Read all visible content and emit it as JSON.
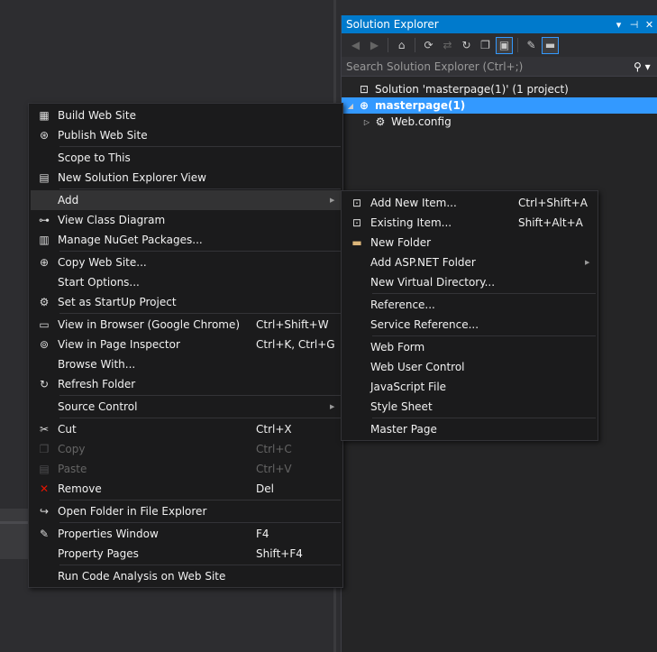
{
  "solution_explorer": {
    "title": "Solution Explorer",
    "title_buttons": [
      "▾",
      "⊣",
      "✕"
    ],
    "toolbar": [
      {
        "name": "back-icon",
        "glyph": "◀",
        "dim": true
      },
      {
        "name": "forward-icon",
        "glyph": "▶",
        "dim": true
      },
      {
        "name": "home-icon",
        "glyph": "⌂"
      },
      {
        "name": "sync-icon",
        "glyph": "⟳"
      },
      {
        "name": "pending-changes-icon",
        "glyph": "⇄",
        "dim": true
      },
      {
        "name": "refresh-icon",
        "glyph": "↻"
      },
      {
        "name": "collapse-all-icon",
        "glyph": "❐"
      },
      {
        "name": "show-all-files-icon",
        "glyph": "▣",
        "on": true
      },
      {
        "name": "properties-icon",
        "glyph": "✎"
      },
      {
        "name": "preview-icon",
        "glyph": "▬",
        "on": true
      }
    ],
    "search_placeholder": "Search Solution Explorer (Ctrl+;)",
    "tree": [
      {
        "label": "Solution 'masterpage(1)' (1 project)",
        "indent": 0,
        "icon": "⊡",
        "arrow": ""
      },
      {
        "label": "masterpage(1)",
        "indent": 0,
        "icon": "⊕",
        "arrow": "◢",
        "selected": true
      },
      {
        "label": "Web.config",
        "indent": 1,
        "icon": "⚙",
        "arrow": "▷"
      }
    ]
  },
  "context_menu": [
    {
      "label": "Build Web Site",
      "icon": "▦"
    },
    {
      "label": "Publish Web Site",
      "icon": "⊛"
    },
    {
      "sep": true
    },
    {
      "label": "Scope to This",
      "icon": ""
    },
    {
      "label": "New Solution Explorer View",
      "icon": "▤"
    },
    {
      "sep": true
    },
    {
      "label": "Add",
      "icon": "",
      "submenu": true,
      "highlight": true
    },
    {
      "label": "View Class Diagram",
      "icon": "⊶"
    },
    {
      "label": "Manage NuGet Packages...",
      "icon": "▥"
    },
    {
      "sep": true
    },
    {
      "label": "Copy Web Site...",
      "icon": "⊕"
    },
    {
      "label": "Start Options...",
      "icon": ""
    },
    {
      "label": "Set as StartUp Project",
      "icon": "⚙"
    },
    {
      "sep": true
    },
    {
      "label": "View in Browser (Google Chrome)",
      "shortcut": "Ctrl+Shift+W",
      "icon": "▭"
    },
    {
      "label": "View in Page Inspector",
      "shortcut": "Ctrl+K, Ctrl+G",
      "icon": "⊚"
    },
    {
      "label": "Browse With...",
      "icon": ""
    },
    {
      "label": "Refresh Folder",
      "icon": "↻"
    },
    {
      "sep": true
    },
    {
      "label": "Source Control",
      "icon": "",
      "submenu": true
    },
    {
      "sep": true
    },
    {
      "label": "Cut",
      "shortcut": "Ctrl+X",
      "icon": "✂"
    },
    {
      "label": "Copy",
      "shortcut": "Ctrl+C",
      "icon": "❐",
      "disabled": true
    },
    {
      "label": "Paste",
      "shortcut": "Ctrl+V",
      "icon": "▤",
      "disabled": true
    },
    {
      "label": "Remove",
      "shortcut": "Del",
      "icon": "✕",
      "iconColor": "#e51400"
    },
    {
      "sep": true
    },
    {
      "label": "Open Folder in File Explorer",
      "icon": "↪"
    },
    {
      "sep": true
    },
    {
      "label": "Properties Window",
      "shortcut": "F4",
      "icon": "✎"
    },
    {
      "label": "Property Pages",
      "shortcut": "Shift+F4",
      "icon": ""
    },
    {
      "sep": true
    },
    {
      "label": "Run Code Analysis on Web Site",
      "icon": ""
    }
  ],
  "add_submenu": [
    {
      "label": "Add New Item...",
      "shortcut": "Ctrl+Shift+A",
      "icon": "⊡"
    },
    {
      "label": "Existing Item...",
      "shortcut": "Shift+Alt+A",
      "icon": "⊡"
    },
    {
      "label": "New Folder",
      "icon": "▬",
      "iconColor": "#dcb67a"
    },
    {
      "label": "Add ASP.NET Folder",
      "icon": "",
      "submenu": true
    },
    {
      "label": "New Virtual Directory...",
      "icon": ""
    },
    {
      "sep": true
    },
    {
      "label": "Reference...",
      "icon": ""
    },
    {
      "label": "Service Reference...",
      "icon": ""
    },
    {
      "sep": true
    },
    {
      "label": "Web Form",
      "icon": ""
    },
    {
      "label": "Web User Control",
      "icon": ""
    },
    {
      "label": "JavaScript File",
      "icon": ""
    },
    {
      "label": "Style Sheet",
      "icon": ""
    },
    {
      "sep": true
    },
    {
      "label": "Master Page",
      "icon": ""
    }
  ]
}
